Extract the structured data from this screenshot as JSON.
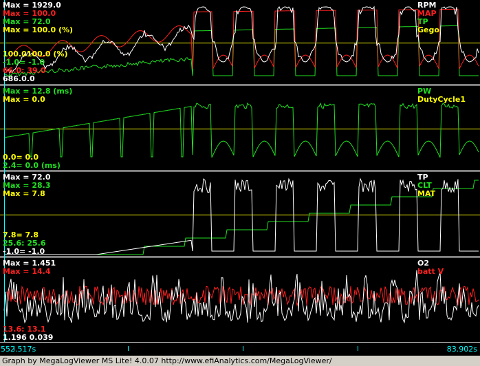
{
  "colors": {
    "background": "#000000",
    "white": "#ffffff",
    "red": "#ff2020",
    "green": "#20e020",
    "yellow": "#ffff00",
    "cyan": "#00ffff",
    "separator": "#c8c8c8"
  },
  "status_bar": {
    "text": "Graph by MegaLogViewer MS Lite! 4.0.07 http://www.efiAnalytics.com/MegaLogViewer/"
  },
  "time_axis": {
    "start_label": "552.517s",
    "end_label": "83.902s"
  },
  "panels": [
    {
      "id": "panel1",
      "max_labels": [
        {
          "text": "Max = 1929.0",
          "color": "white"
        },
        {
          "text": "Max = 100.0",
          "color": "red"
        },
        {
          "text": "Max = 72.0",
          "color": "green"
        },
        {
          "text": "Max = 100.0 (%)",
          "color": "yellow"
        }
      ],
      "legend": [
        {
          "text": "RPM",
          "color": "white"
        },
        {
          "text": "MAP",
          "color": "red"
        },
        {
          "text": "TP",
          "color": "green"
        },
        {
          "text": "Gego",
          "color": "yellow"
        }
      ],
      "cursor_labels": [
        {
          "text": "100.0100.0 (%)",
          "color": "yellow"
        },
        {
          "text": "-1.0= -1.0",
          "color": "green"
        },
        {
          "text": "66.0: 39.0",
          "color": "red"
        },
        {
          "text": "686.0.0",
          "color": "white"
        }
      ],
      "chart_data": {
        "type": "line",
        "series": [
          {
            "name": "RPM",
            "color": "white"
          },
          {
            "name": "MAP",
            "color": "red"
          },
          {
            "name": "TP",
            "color": "green"
          },
          {
            "name": "Gego",
            "color": "yellow"
          }
        ],
        "ylim": {
          "RPM": [
            0,
            1929.0
          ],
          "MAP": [
            0,
            100.0
          ],
          "TP": [
            -1.0,
            72.0
          ],
          "Gego": [
            0,
            100.0
          ]
        }
      }
    },
    {
      "id": "panel2",
      "max_labels": [
        {
          "text": "Max = 12.8 (ms)",
          "color": "green"
        },
        {
          "text": "Max = 0.0",
          "color": "yellow"
        }
      ],
      "legend": [
        {
          "text": "PW",
          "color": "green"
        },
        {
          "text": "DutyCycle1",
          "color": "yellow"
        }
      ],
      "cursor_labels": [
        {
          "text": "0.0= 0.0",
          "color": "yellow"
        },
        {
          "text": "2.4= 0.0 (ms)",
          "color": "green"
        }
      ],
      "chart_data": {
        "type": "line",
        "series": [
          {
            "name": "PW",
            "color": "green"
          },
          {
            "name": "DutyCycle1",
            "color": "yellow"
          }
        ],
        "ylim": {
          "PW": [
            0,
            12.8
          ],
          "DutyCycle1": [
            0,
            0.0
          ]
        }
      }
    },
    {
      "id": "panel3",
      "max_labels": [
        {
          "text": "Max = 72.0",
          "color": "white"
        },
        {
          "text": "Max = 28.3",
          "color": "green"
        },
        {
          "text": "Max = 7.8",
          "color": "yellow"
        }
      ],
      "legend": [
        {
          "text": "TP",
          "color": "white"
        },
        {
          "text": "CLT",
          "color": "green"
        },
        {
          "text": "MAT",
          "color": "yellow"
        }
      ],
      "cursor_labels": [
        {
          "text": "7.8= 7.8",
          "color": "yellow"
        },
        {
          "text": "25.6: 25.6",
          "color": "green"
        },
        {
          "text": "-1.0= -1.0",
          "color": "white"
        }
      ],
      "chart_data": {
        "type": "line",
        "series": [
          {
            "name": "TP",
            "color": "white"
          },
          {
            "name": "CLT",
            "color": "green"
          },
          {
            "name": "MAT",
            "color": "yellow"
          }
        ],
        "ylim": {
          "TP": [
            -1.0,
            72.0
          ],
          "CLT": [
            25.6,
            28.3
          ],
          "MAT": [
            7.8,
            7.8
          ]
        }
      }
    },
    {
      "id": "panel4",
      "max_labels": [
        {
          "text": "Max = 1.451",
          "color": "white"
        },
        {
          "text": "Max = 14.4",
          "color": "red"
        }
      ],
      "legend": [
        {
          "text": "O2",
          "color": "white"
        },
        {
          "text": "batt V",
          "color": "red"
        }
      ],
      "cursor_labels": [
        {
          "text": "13.6: 13.1",
          "color": "red"
        },
        {
          "text": "1.196 0.039",
          "color": "white"
        }
      ],
      "chart_data": {
        "type": "line",
        "series": [
          {
            "name": "O2",
            "color": "white"
          },
          {
            "name": "batt V",
            "color": "red"
          }
        ],
        "ylim": {
          "O2": [
            0,
            1.451
          ],
          "batt V": [
            13.1,
            14.4
          ]
        }
      }
    }
  ]
}
